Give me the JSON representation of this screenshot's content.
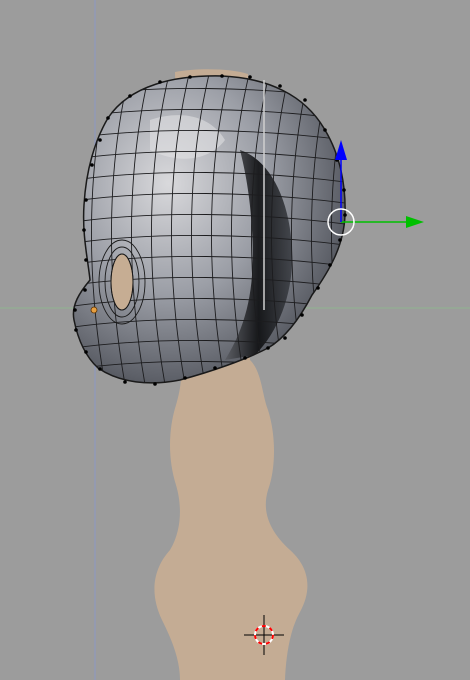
{
  "viewport": {
    "view": "3d-viewport",
    "mode": "edit-mode",
    "background_color": "#9c9c9c",
    "skin_color": "#c6ad93",
    "mesh_color": "#8a8d94",
    "vertex_color": "#000000",
    "x_axis_color": "#7fb27f",
    "y_axis_color": "#8a96c8",
    "manipulator": {
      "x_arrow_color": "#00c000",
      "z_arrow_color": "#0000ff",
      "center_ring_color": "#ffffff"
    },
    "cursor": {
      "icon": "3d-cursor-icon",
      "ring_colors": [
        "#ff0000",
        "#ffffff"
      ]
    },
    "objects": [
      {
        "name": "head-mesh",
        "state": "edit-mesh"
      },
      {
        "name": "body-reference",
        "state": "background-silhouette"
      }
    ]
  }
}
